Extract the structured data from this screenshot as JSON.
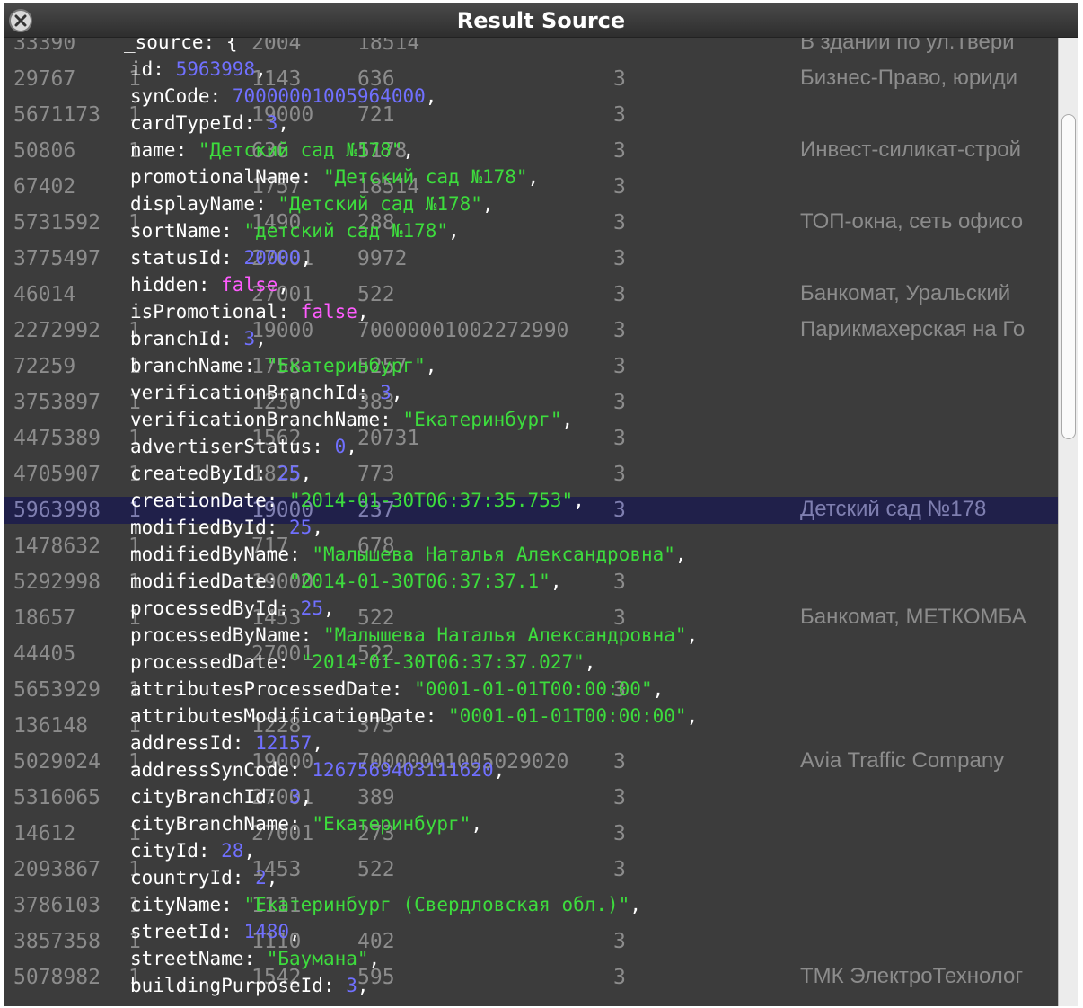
{
  "window": {
    "title": "Result Source"
  },
  "background_rows": [
    {
      "id": "33390",
      "c2": "",
      "c3": "2004",
      "c4": "18514",
      "c5num": "",
      "c5": "В здании по ул.Твери"
    },
    {
      "id": "29767",
      "c2": "1",
      "c3": "1143",
      "c4": "636",
      "c5num": "3",
      "c5": "Бизнес-Право, юриди"
    },
    {
      "id": "5671173",
      "c2": "1",
      "c3": "19000",
      "c4": "721",
      "c5num": "3",
      "c5": ""
    },
    {
      "id": "50806",
      "c2": "1",
      "c3": "636",
      "c4": "5178",
      "c5num": "3",
      "c5": "Инвест-силикат-строй"
    },
    {
      "id": "67402",
      "c2": "",
      "c3": "1757",
      "c4": "18514",
      "c5num": "3",
      "c5": ""
    },
    {
      "id": "5731592",
      "c2": "1",
      "c3": "1490",
      "c4": "288",
      "c5num": "3",
      "c5": "ТОП-окна, сеть офисо"
    },
    {
      "id": "3775497",
      "c2": "",
      "c3": "27001",
      "c4": "9972",
      "c5num": "3",
      "c5": ""
    },
    {
      "id": "46014",
      "c2": "",
      "c3": "27001",
      "c4": "522",
      "c5num": "3",
      "c5": "Банкомат, Уральский"
    },
    {
      "id": "2272992",
      "c2": "1",
      "c3": "19000",
      "c4": "70000001002272990",
      "c5num": "3",
      "c5": "Парикмахерская на Го"
    },
    {
      "id": "72259",
      "c2": "1",
      "c3": "1758",
      "c4": "5257",
      "c5num": "3",
      "c5": ""
    },
    {
      "id": "3753897",
      "c2": "1",
      "c3": "1230",
      "c4": "383",
      "c5num": "3",
      "c5": ""
    },
    {
      "id": "4475389",
      "c2": "1",
      "c3": "1562",
      "c4": "20731",
      "c5num": "3",
      "c5": ""
    },
    {
      "id": "4705907",
      "c2": "1",
      "c3": "1825",
      "c4": "773",
      "c5num": "3",
      "c5": ""
    },
    {
      "id": "5963998",
      "c2": "1",
      "c3": "19000",
      "c4": "237",
      "c5num": "3",
      "c5": "Детский сад №178",
      "selected": true
    },
    {
      "id": "1478632",
      "c2": "1",
      "c3": "717",
      "c4": "678",
      "c5num": "",
      "c5": ""
    },
    {
      "id": "5292998",
      "c2": "1",
      "c3": "19000",
      "c4": "",
      "c5num": "3",
      "c5": ""
    },
    {
      "id": "18657",
      "c2": "1",
      "c3": "1453",
      "c4": "522",
      "c5num": "3",
      "c5": "Банкомат, МЕТКОМБА"
    },
    {
      "id": "44405",
      "c2": "",
      "c3": "27001",
      "c4": "522",
      "c5num": "",
      "c5": ""
    },
    {
      "id": "5653929",
      "c2": "1",
      "c3": "",
      "c4": "",
      "c5num": "3",
      "c5": ""
    },
    {
      "id": "136148",
      "c2": "1",
      "c3": "1228",
      "c4": "373",
      "c5num": "",
      "c5": ""
    },
    {
      "id": "5029024",
      "c2": "1",
      "c3": "19000",
      "c4": "70000001005029020",
      "c5num": "3",
      "c5": "Avia Traffic Company"
    },
    {
      "id": "5316065",
      "c2": "",
      "c3": "27001",
      "c4": "389",
      "c5num": "3",
      "c5": ""
    },
    {
      "id": "14612",
      "c2": "1",
      "c3": "27001",
      "c4": "273",
      "c5num": "3",
      "c5": ""
    },
    {
      "id": "2093867",
      "c2": "1",
      "c3": "1453",
      "c4": "522",
      "c5num": "3",
      "c5": ""
    },
    {
      "id": "3786103",
      "c2": "1",
      "c3": "1111",
      "c4": "",
      "c5num": "",
      "c5": ""
    },
    {
      "id": "3857358",
      "c2": "1",
      "c3": "1110",
      "c4": "402",
      "c5num": "3",
      "c5": ""
    },
    {
      "id": "5078982",
      "c2": "1",
      "c3": "1542",
      "c4": "595",
      "c5num": "3",
      "c5": "ТМК ЭлектроТехнолог"
    }
  ],
  "source_lines": [
    {
      "key": "_source",
      "val": "{",
      "type": "brace"
    },
    {
      "key": "id",
      "val": "5963998",
      "type": "num"
    },
    {
      "key": "synCode",
      "val": "70000001005964000",
      "type": "num"
    },
    {
      "key": "cardTypeId",
      "val": "3",
      "type": "num"
    },
    {
      "key": "name",
      "val": "\"Детский сад №178\"",
      "type": "str"
    },
    {
      "key": "promotionalName",
      "val": "\"Детский сад №178\"",
      "type": "str"
    },
    {
      "key": "displayName",
      "val": "\"Детский сад №178\"",
      "type": "str"
    },
    {
      "key": "sortName",
      "val": "\"детский сад №178\"",
      "type": "str"
    },
    {
      "key": "statusId",
      "val": "20000",
      "type": "num"
    },
    {
      "key": "hidden",
      "val": "false",
      "type": "bool"
    },
    {
      "key": "isPromotional",
      "val": "false",
      "type": "bool"
    },
    {
      "key": "branchId",
      "val": "3",
      "type": "num"
    },
    {
      "key": "branchName",
      "val": "\"Екатеринбург\"",
      "type": "str"
    },
    {
      "key": "verificationBranchId",
      "val": "3",
      "type": "num"
    },
    {
      "key": "verificationBranchName",
      "val": "\"Екатеринбург\"",
      "type": "str"
    },
    {
      "key": "advertiserStatus",
      "val": "0",
      "type": "num"
    },
    {
      "key": "createdById",
      "val": "25",
      "type": "num"
    },
    {
      "key": "creationDate",
      "val": "\"2014-01-30T06:37:35.753\"",
      "type": "str"
    },
    {
      "key": "modifiedById",
      "val": "25",
      "type": "num"
    },
    {
      "key": "modifiedByName",
      "val": "\"Малышева Наталья Александровна\"",
      "type": "str"
    },
    {
      "key": "modifiedDate",
      "val": "\"2014-01-30T06:37:37.1\"",
      "type": "str"
    },
    {
      "key": "processedById",
      "val": "25",
      "type": "num"
    },
    {
      "key": "processedByName",
      "val": "\"Малышева Наталья Александровна\"",
      "type": "str"
    },
    {
      "key": "processedDate",
      "val": "\"2014-01-30T06:37:37.027\"",
      "type": "str"
    },
    {
      "key": "attributesProcessedDate",
      "val": "\"0001-01-01T00:00:00\"",
      "type": "str"
    },
    {
      "key": "attributesModificationDate",
      "val": "\"0001-01-01T00:00:00\"",
      "type": "str"
    },
    {
      "key": "addressId",
      "val": "12157",
      "type": "num"
    },
    {
      "key": "addressSynCode",
      "val": "1267569403111620",
      "type": "num"
    },
    {
      "key": "cityBranchId",
      "val": "3",
      "type": "num"
    },
    {
      "key": "cityBranchName",
      "val": "\"Екатеринбург\"",
      "type": "str"
    },
    {
      "key": "cityId",
      "val": "28",
      "type": "num"
    },
    {
      "key": "countryId",
      "val": "2",
      "type": "num"
    },
    {
      "key": "cityName",
      "val": "\"Екатеринбург (Свердловская обл.)\"",
      "type": "str"
    },
    {
      "key": "streetId",
      "val": "1480",
      "type": "num"
    },
    {
      "key": "streetName",
      "val": "\"Баумана\"",
      "type": "str"
    },
    {
      "key": "buildingPurposeId",
      "val": "3",
      "type": "num"
    }
  ],
  "colors": {
    "number": "#7070ff",
    "string": "#3ddc3d",
    "boolean": "#ff5cff",
    "selection": "#20204a"
  },
  "icons": {
    "close": "close-icon"
  }
}
